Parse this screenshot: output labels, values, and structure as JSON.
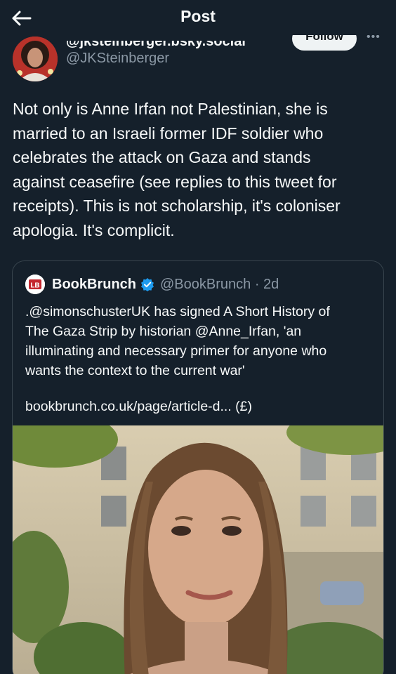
{
  "header": {
    "title": "Post",
    "back_icon": "arrow-left-icon"
  },
  "author": {
    "display_name": "@jksteinberger.bsky.social",
    "handle": "@JKSteinberger",
    "follow_label": "Follow",
    "more_icon": "more-dots-icon"
  },
  "tweet": {
    "lines": [
      "Not only is Anne Irfan not Palestinian, she is",
      "married to an Israeli former IDF soldier who",
      "celebrates the attack on Gaza and stands",
      "against ceasefire (see replies to this tweet for",
      "receipts). This is not scholarship, it's coloniser",
      "apologia. It's complicit."
    ]
  },
  "quote": {
    "logo_text": "LB",
    "name": "BookBrunch",
    "verified_icon": "verified-badge-icon",
    "handle_time": "@BookBrunch · 2d",
    "lines": [
      ".@simonschusterUK has signed A Short History of",
      "The Gaza Strip by historian @Anne_Irfan, 'an",
      "illuminating and necessary primer for anyone who",
      "wants the context to the current war'"
    ],
    "link": "bookbrunch.co.uk/page/article-d... (£)"
  },
  "colors": {
    "background": "#15202b",
    "text": "#f7f9f9",
    "muted": "#8b98a5",
    "border": "#38444d",
    "verified": "#1d9bf0"
  }
}
